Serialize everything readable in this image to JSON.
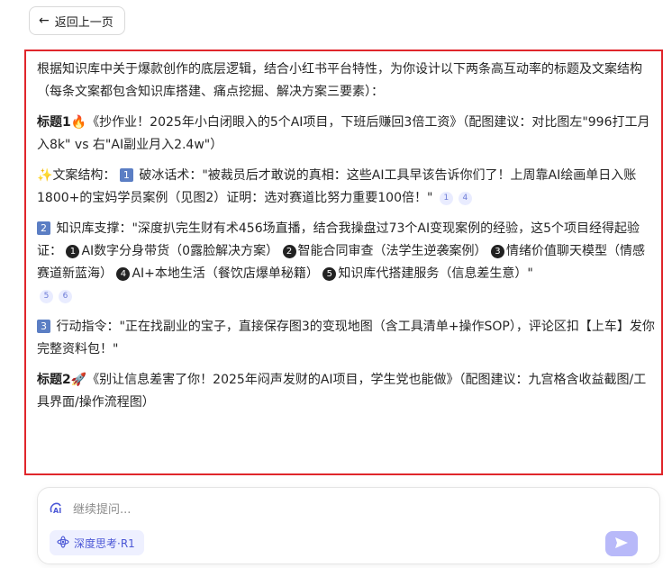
{
  "back_button": {
    "label": "返回上一页"
  },
  "answer": {
    "intro": "根据知识库中关于爆款创作的底层逻辑，结合小红书平台特性，为你设计以下两条高互动率的标题及文案结构（每条文案都包含知识库搭建、痛点挖掘、解决方案三要素）：",
    "title1": {
      "label": "标题1",
      "icon": "fire-emoji",
      "text": "《抄作业！2025年小白闭眼入的5个AI项目，下班后赚回3倍工资》（配图建议：对比图左\"996打工月入8k\" vs 右\"AI副业月入2.4w\"）"
    },
    "structure": {
      "icon": "sparkle-emoji",
      "label": "文案结构：",
      "step1_num": "1",
      "step1_text": "破冰话术：\"被裁员后才敢说的真相：这些AI工具早该告诉你们了！上周靠AI绘画单日入账1800+的宝妈学员案例（见图2）证明：选对赛道比努力重要100倍！\"",
      "cites": [
        "1",
        "4"
      ]
    },
    "step2": {
      "num": "2",
      "text_a": "知识库支撑：\"深度扒完生财有术456场直播，结合我操盘过73个AI变现案例的经验，这5个项目经得起验证：",
      "items": [
        {
          "bullet": "1",
          "text": "AI数字分身带货（0露脸解决方案）"
        },
        {
          "bullet": "2",
          "text": "智能合同审查（法学生逆袭案例）"
        },
        {
          "bullet": "3",
          "text": "情绪价值聊天模型（情感赛道新蓝海）"
        },
        {
          "bullet": "4",
          "text": "AI+本地生活（餐饮店爆单秘籍）"
        },
        {
          "bullet": "5",
          "text": "知识库代搭建服务（信息差生意）\""
        }
      ],
      "cites": [
        "5",
        "6"
      ]
    },
    "step3": {
      "num": "3",
      "text": "行动指令：\"正在找副业的宝子，直接保存图3的变现地图（含工具清单+操作SOP），评论区扣【上车】发你完整资料包！\""
    },
    "title2": {
      "label": "标题2",
      "icon": "rocket-emoji",
      "text": "《别让信息差害了你！2025年闷声发财的AI项目，学生党也能做》（配图建议：九宫格含收益截图/工具界面/操作流程图）"
    }
  },
  "composer": {
    "placeholder": "继续提问...",
    "deep_think_label": "深度思考·R1",
    "accent": "#4a56d6",
    "send_color": "#b8b9f9"
  },
  "highlight_color": "#e0262b"
}
